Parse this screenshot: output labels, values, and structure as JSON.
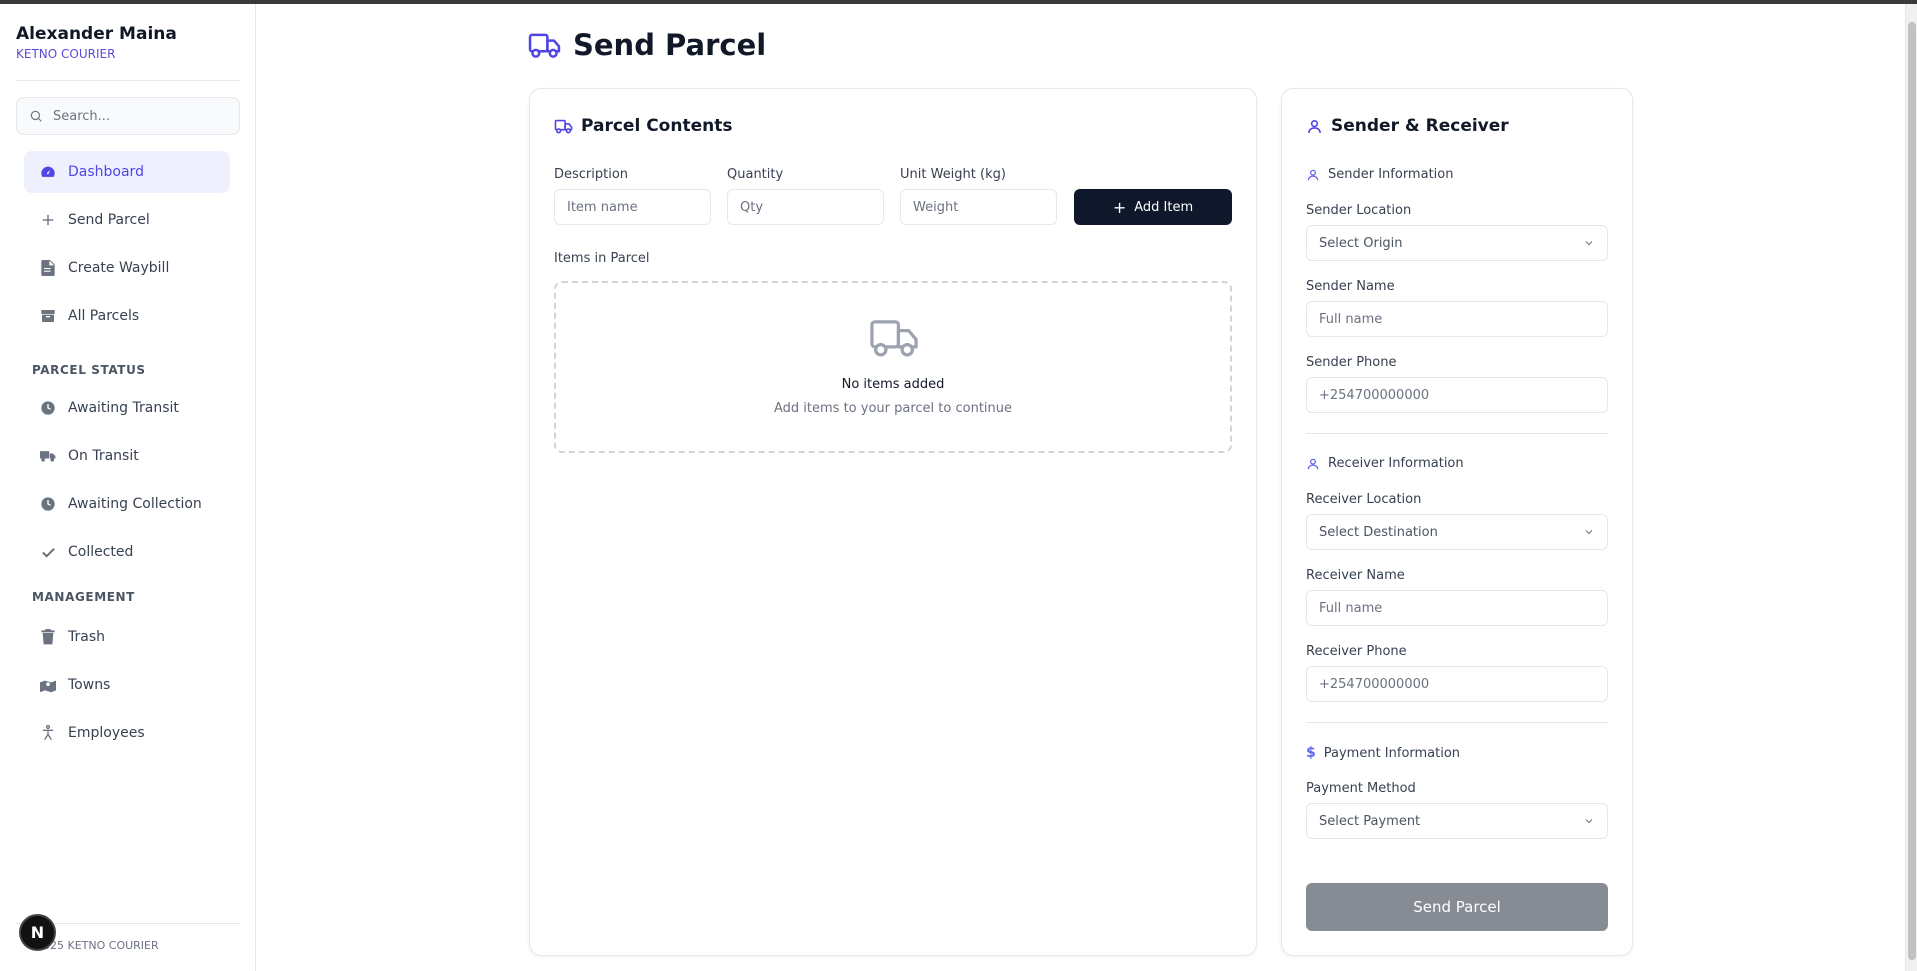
{
  "sidebar": {
    "user_name": "Alexander Maina",
    "company": "KETNO COURIER",
    "search_placeholder": "Search...",
    "nav": [
      {
        "label": "Dashboard",
        "icon": "dashboard-icon",
        "active": true
      },
      {
        "label": "Send Parcel",
        "icon": "plus-icon"
      },
      {
        "label": "Create Waybill",
        "icon": "document-icon"
      },
      {
        "label": "All Parcels",
        "icon": "package-icon"
      }
    ],
    "parcel_status_label": "PARCEL STATUS",
    "status_nav": [
      {
        "label": "Awaiting Transit",
        "icon": "clock-icon"
      },
      {
        "label": "On Transit",
        "icon": "truck-icon"
      },
      {
        "label": "Awaiting Collection",
        "icon": "clock-icon"
      },
      {
        "label": "Collected",
        "icon": "check-icon"
      }
    ],
    "management_label": "MANAGEMENT",
    "management_nav": [
      {
        "label": "Trash",
        "icon": "trash-icon"
      },
      {
        "label": "Towns",
        "icon": "map-icon"
      },
      {
        "label": "Employees",
        "icon": "person-icon"
      }
    ],
    "footer": "2025 KETNO COURIER",
    "badge": "N"
  },
  "page": {
    "title": "Send Parcel"
  },
  "contents": {
    "title": "Parcel Contents",
    "description_label": "Description",
    "description_placeholder": "Item name",
    "quantity_label": "Quantity",
    "quantity_placeholder": "Qty",
    "weight_label": "Unit Weight (kg)",
    "weight_placeholder": "Weight",
    "add_item": "Add Item",
    "items_label": "Items in Parcel",
    "empty_title": "No items added",
    "empty_sub": "Add items to your parcel to continue"
  },
  "parties": {
    "title": "Sender & Receiver",
    "sender_heading": "Sender Information",
    "sender_location_label": "Sender Location",
    "sender_location_value": "Select Origin",
    "sender_name_label": "Sender Name",
    "sender_name_placeholder": "Full name",
    "sender_phone_label": "Sender Phone",
    "sender_phone_placeholder": "+254700000000",
    "receiver_heading": "Receiver Information",
    "receiver_location_label": "Receiver Location",
    "receiver_location_value": "Select Destination",
    "receiver_name_label": "Receiver Name",
    "receiver_name_placeholder": "Full name",
    "receiver_phone_label": "Receiver Phone",
    "receiver_phone_placeholder": "+254700000000",
    "payment_heading": "Payment Information",
    "payment_method_label": "Payment Method",
    "payment_method_value": "Select Payment",
    "send_button": "Send Parcel"
  },
  "colors": {
    "accent": "#4f46e5",
    "primary_dark": "#0f172a",
    "disabled_button": "#878b94"
  }
}
